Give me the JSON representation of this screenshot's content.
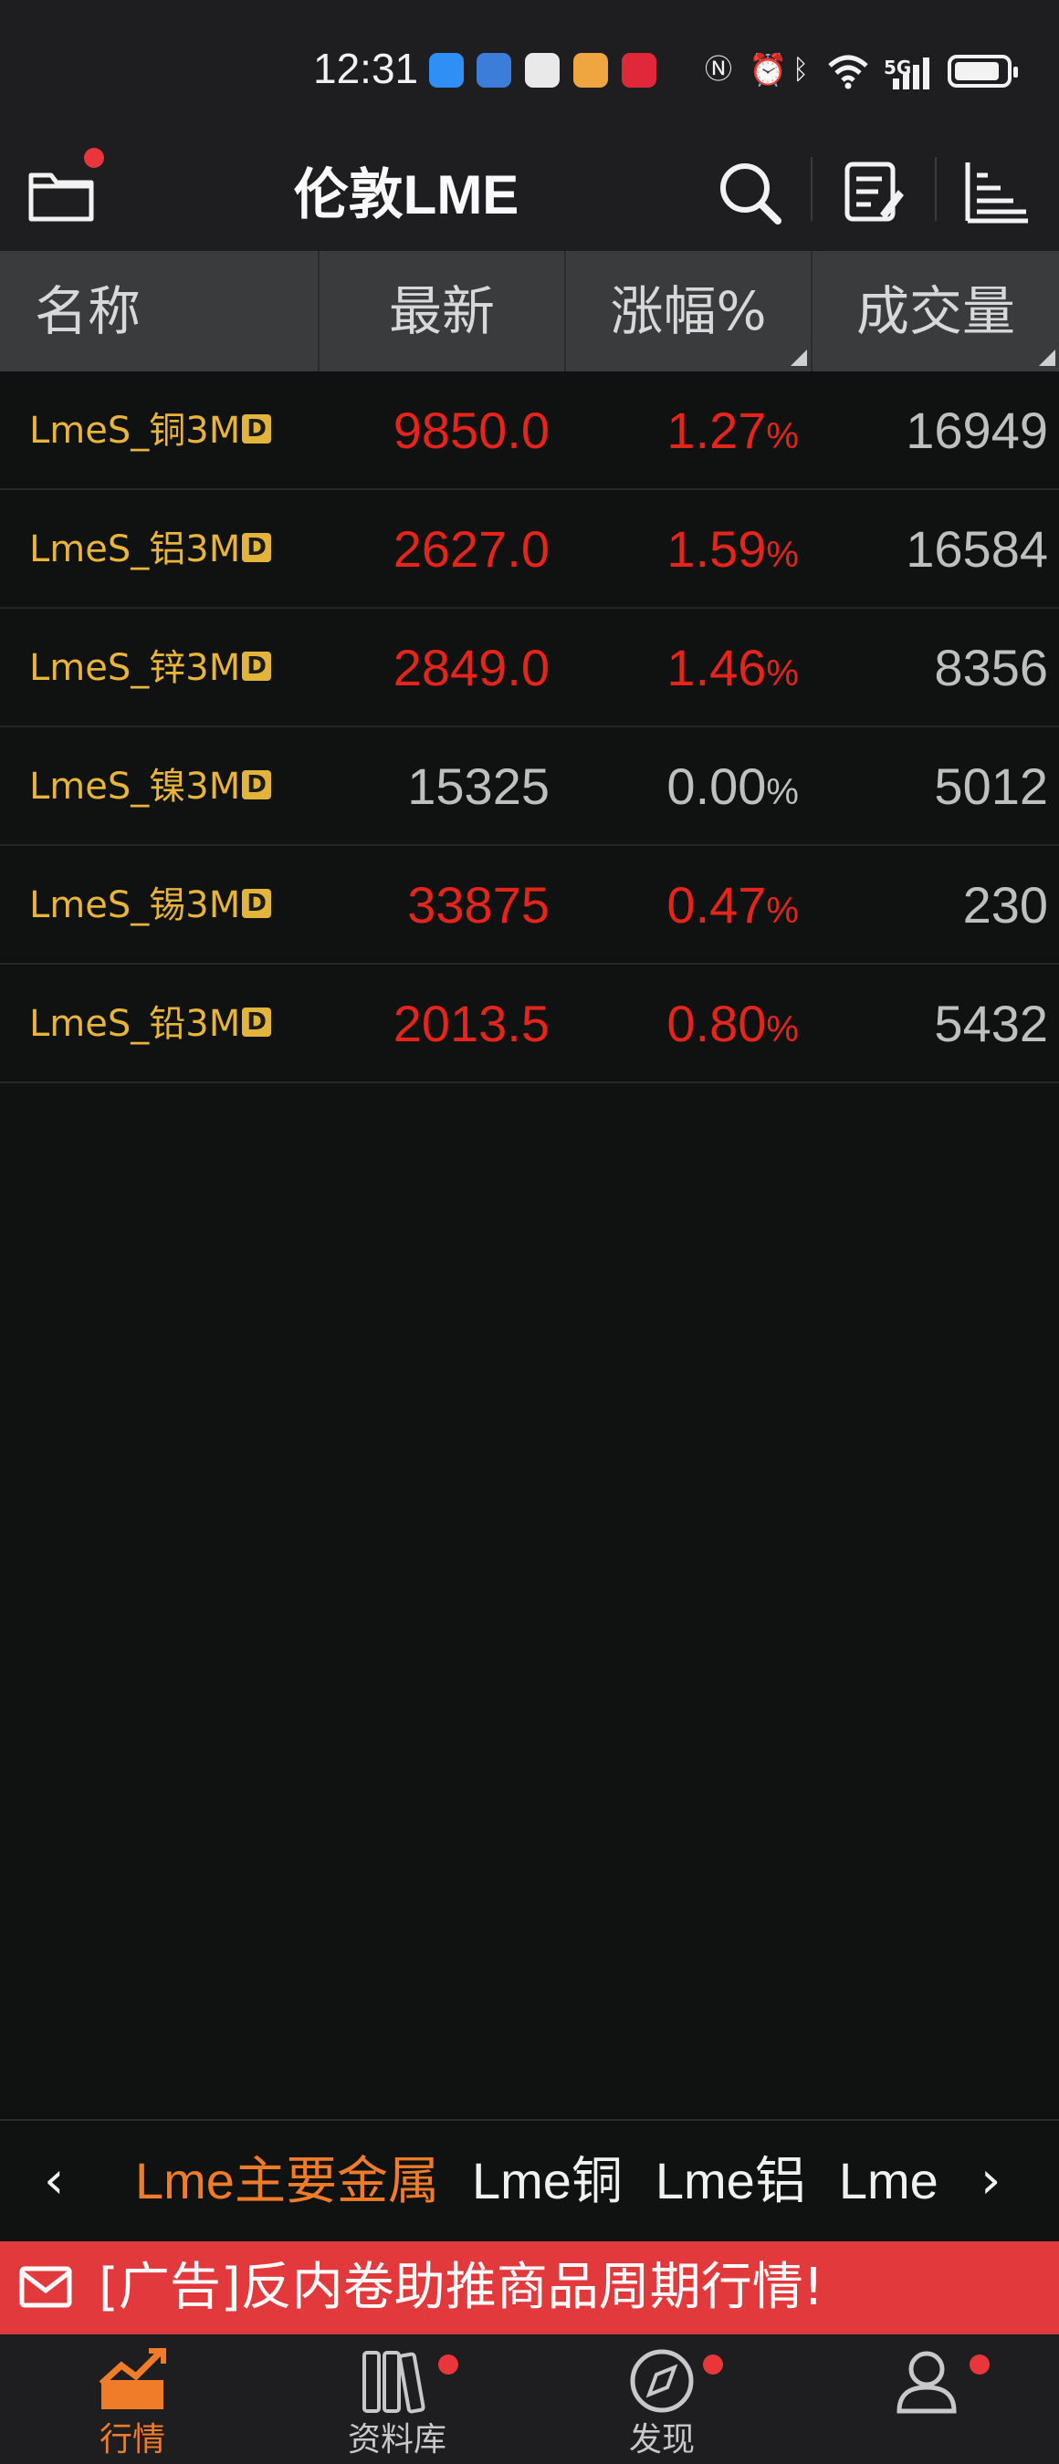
{
  "status_bar": {
    "time": "12:31",
    "network": "5G"
  },
  "header": {
    "title": "伦敦LME"
  },
  "columns": {
    "name": "名称",
    "latest": "最新",
    "change": "涨幅%",
    "volume": "成交量"
  },
  "rows": [
    {
      "name": "LmeS_铜3M",
      "badge": "D",
      "latest": "9850.0",
      "change": "1.27",
      "unit": "%",
      "volume": "16949",
      "trend": "up"
    },
    {
      "name": "LmeS_铝3M",
      "badge": "D",
      "latest": "2627.0",
      "change": "1.59",
      "unit": "%",
      "volume": "16584",
      "trend": "up"
    },
    {
      "name": "LmeS_锌3M",
      "badge": "D",
      "latest": "2849.0",
      "change": "1.46",
      "unit": "%",
      "volume": "8356",
      "trend": "up"
    },
    {
      "name": "LmeS_镍3M",
      "badge": "D",
      "latest": "15325",
      "change": "0.00",
      "unit": "%",
      "volume": "5012",
      "trend": "flat"
    },
    {
      "name": "LmeS_锡3M",
      "badge": "D",
      "latest": "33875",
      "change": "0.47",
      "unit": "%",
      "volume": "230",
      "trend": "up"
    },
    {
      "name": "LmeS_铅3M",
      "badge": "D",
      "latest": "2013.5",
      "change": "0.80",
      "unit": "%",
      "volume": "5432",
      "trend": "up"
    }
  ],
  "categories": [
    "Lme主要金属",
    "Lme铜",
    "Lme铝",
    "Lme锌"
  ],
  "ad": {
    "text": "[广告]反内卷助推商品周期行情!"
  },
  "nav": [
    {
      "label": "行情",
      "icon": "market-chart-icon"
    },
    {
      "label": "资料库",
      "icon": "library-icon"
    },
    {
      "label": "发现",
      "icon": "compass-icon"
    },
    {
      "label": "",
      "icon": "profile-icon"
    }
  ],
  "colors": {
    "up": "#e6241c",
    "flat": "#bfbfbf",
    "accent": "#f07c2a",
    "name": "#e8b53a",
    "ad_bg": "#e23a3c"
  }
}
